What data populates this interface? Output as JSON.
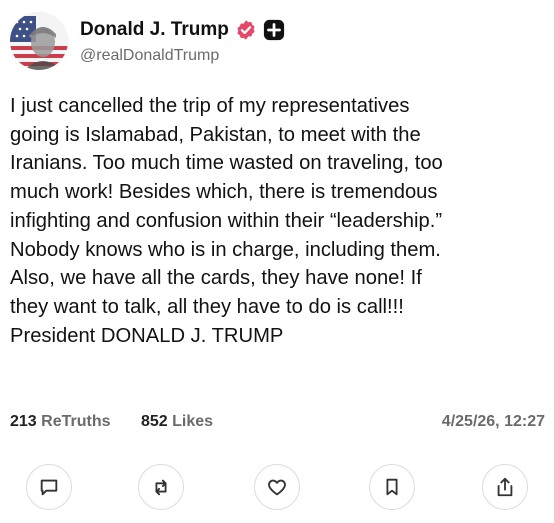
{
  "author": {
    "display_name": "Donald J. Trump",
    "handle": "@realDonaldTrump",
    "avatar_icon": "flag-portrait-avatar",
    "verified_icon": "verified-badge-icon",
    "verified_color": "#e44a68",
    "plus_icon": "plus-badge-icon"
  },
  "post": {
    "text": "I just cancelled the trip of my representatives\ngoing is Islamabad, Pakistan, to meet with the\nIranians. Too much time wasted on traveling, too\nmuch work! Besides which, there is tremendous\ninfighting and confusion within their “leadership.”\nNobody knows who is in charge, including them.\nAlso, we have all the cards, they have none! If\nthey want to talk, all they have to do is call!!!\nPresident DONALD J. TRUMP"
  },
  "stats": {
    "retruths_count": "213",
    "retruths_label": "ReTruths",
    "likes_count": "852",
    "likes_label": "Likes",
    "timestamp": "4/25/26, 12:27"
  },
  "actions": [
    {
      "name": "reply",
      "icon": "comment-icon"
    },
    {
      "name": "retruth",
      "icon": "repost-icon"
    },
    {
      "name": "like",
      "icon": "heart-icon"
    },
    {
      "name": "bookmark",
      "icon": "bookmark-icon"
    },
    {
      "name": "share",
      "icon": "share-icon"
    }
  ]
}
